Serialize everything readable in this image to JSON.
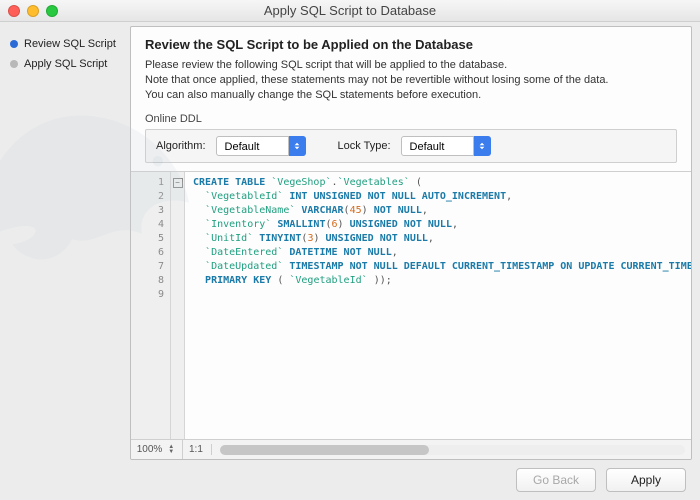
{
  "window": {
    "title": "Apply SQL Script to Database"
  },
  "sidebar": {
    "steps": [
      {
        "label": "Review SQL Script",
        "active": true
      },
      {
        "label": "Apply SQL Script",
        "active": false
      }
    ]
  },
  "main": {
    "heading": "Review the SQL Script to be Applied on the Database",
    "desc_line1": "Please review the following SQL script that will be applied to the database.",
    "desc_line2": "Note that once applied, these statements may not be revertible without losing some of the data.",
    "desc_line3": "You can also manually change the SQL statements before execution.",
    "ddl_group_label": "Online DDL",
    "algorithm_label": "Algorithm:",
    "algorithm_value": "Default",
    "locktype_label": "Lock Type:",
    "locktype_value": "Default"
  },
  "editor": {
    "line_count": 9,
    "zoom": "100%",
    "ratio": "1:1",
    "sql": {
      "schema": "VegeShop",
      "table": "Vegetables",
      "columns": [
        {
          "name": "VegetableId",
          "def": "INT UNSIGNED NOT NULL AUTO_INCREMENT"
        },
        {
          "name": "VegetableName",
          "def": "VARCHAR(45) NOT NULL"
        },
        {
          "name": "Inventory",
          "def": "SMALLINT(6) UNSIGNED NOT NULL"
        },
        {
          "name": "UnitId",
          "def": "TINYINT(3) UNSIGNED NOT NULL"
        },
        {
          "name": "DateEntered",
          "def": "DATETIME NOT NULL"
        },
        {
          "name": "DateUpdated",
          "def": "TIMESTAMP NOT NULL DEFAULT CURRENT_TIMESTAMP ON UPDATE CURRENT_TIMESTAMP"
        }
      ],
      "primary_key": "VegetableId"
    }
  },
  "footer": {
    "back_label": "Go Back",
    "apply_label": "Apply"
  }
}
